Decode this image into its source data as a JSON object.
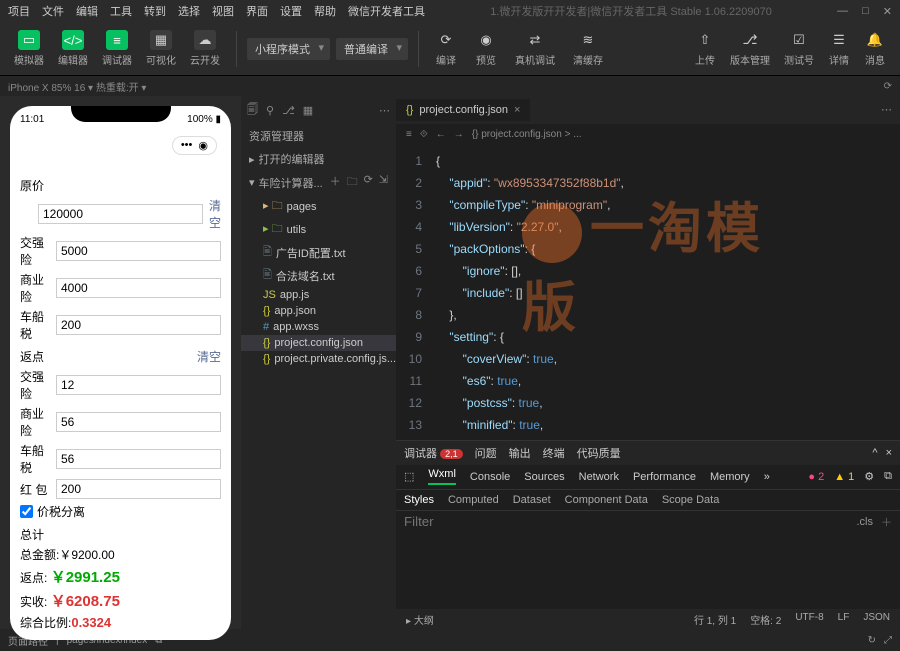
{
  "menu": [
    "项目",
    "文件",
    "编辑",
    "工具",
    "转到",
    "选择",
    "视图",
    "界面",
    "设置",
    "帮助",
    "微信开发者工具"
  ],
  "title": "1.微开发版开开发者|微信开发者工具 Stable 1.06.2209070",
  "toolbar": {
    "sim": "模拟器",
    "editor": "编辑器",
    "debug": "调试器",
    "visual": "可视化",
    "cloud": "云开发",
    "compile": "编译",
    "preview": "预览",
    "realdbg": "真机调试",
    "clear": "清缓存",
    "upload": "上传",
    "version": "版本管理",
    "test": "测试号",
    "detail": "详情",
    "msg": "消息",
    "mode": "小程序模式",
    "compileMode": "普通编译"
  },
  "subbar": {
    "left": "iPhone X 85% 16 ▾  热重载:开 ▾",
    "right": "⟳"
  },
  "phone": {
    "time": "11:01",
    "battery": "100%",
    "labels": {
      "price": "原价",
      "jqx": "交强险",
      "syx": "商业险",
      "ccs": "车船税",
      "fd": "返点",
      "hb": "红 包",
      "sep": "价税分离",
      "total": "总计"
    },
    "values": {
      "price": "120000",
      "jqx": "5000",
      "syx": "4000",
      "ccs": "200",
      "jqx2": "12",
      "syx2": "56",
      "ccs2": "56",
      "hb": "200"
    },
    "clear": "清空",
    "sum": {
      "total": "总金额:￥9200.00",
      "fd": "返点:",
      "fdv": "￥2991.25",
      "ss": "实收:",
      "ssv": "￥6208.75",
      "ratio": "综合比例:",
      "ratiov": "0.3324"
    }
  },
  "explorer": {
    "title": "资源管理器",
    "open": "打开的编辑器",
    "project": "车险计算器...",
    "items": [
      {
        "name": "pages",
        "type": "folder"
      },
      {
        "name": "utils",
        "type": "folder-g"
      },
      {
        "name": "广告ID配置.txt",
        "type": "file"
      },
      {
        "name": "合法域名.txt",
        "type": "file"
      },
      {
        "name": "app.js",
        "type": "js"
      },
      {
        "name": "app.json",
        "type": "json"
      },
      {
        "name": "app.wxss",
        "type": "wxss"
      },
      {
        "name": "project.config.json",
        "type": "json",
        "selected": true
      },
      {
        "name": "project.private.config.js...",
        "type": "json"
      }
    ]
  },
  "editor": {
    "tab": "project.config.json",
    "crumb": "{} project.config.json > ...",
    "lines": [
      {
        "n": "1",
        "t": "{"
      },
      {
        "n": "2",
        "k": "appid",
        "v": "wx8953347352f88b1d",
        "c": ","
      },
      {
        "n": "3",
        "k": "compileType",
        "v": "miniprogram",
        "c": ","
      },
      {
        "n": "4",
        "k": "libVersion",
        "v": "2.27.0",
        "c": ","
      },
      {
        "n": "5",
        "k": "packOptions",
        "o": ": {"
      },
      {
        "n": "6",
        "k": "ignore",
        "o": ": [],"
      },
      {
        "n": "7",
        "k": "include",
        "o": ": []"
      },
      {
        "n": "8",
        "t": "},"
      },
      {
        "n": "9",
        "k": "setting",
        "o": ": {"
      },
      {
        "n": "10",
        "k": "coverView",
        "b": "true",
        "c": ","
      },
      {
        "n": "11",
        "k": "es6",
        "b": "true",
        "c": ","
      },
      {
        "n": "12",
        "k": "postcss",
        "b": "true",
        "c": ","
      },
      {
        "n": "13",
        "k": "minified",
        "b": "true",
        "c": ","
      }
    ],
    "watermark": "一淘模版"
  },
  "debugger": {
    "label": "调试器",
    "badge": "2,1",
    "tabs": [
      "问题",
      "输出",
      "终端",
      "代码质量"
    ],
    "tools": [
      "Wxml",
      "Console",
      "Sources",
      "Network",
      "Performance",
      "Memory"
    ],
    "sub": [
      "Styles",
      "Computed",
      "Dataset",
      "Component Data",
      "Scope Data"
    ],
    "filter": "Filter",
    "cls": ".cls",
    "err": "● 2",
    "warn": "▲ 1"
  },
  "bottombar": {
    "path": "页面路径",
    "val": "pages/index/index"
  },
  "status": {
    "outline": "大纲",
    "pos": "行 1, 列 1",
    "space": "空格: 2",
    "enc": "UTF-8",
    "eol": "LF",
    "lang": "JSON"
  }
}
